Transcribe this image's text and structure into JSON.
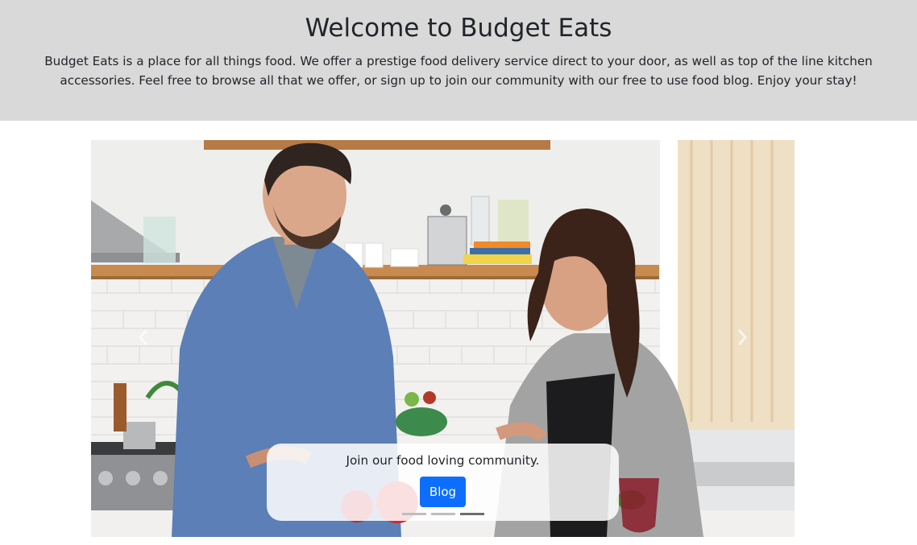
{
  "header": {
    "title": "Welcome to Budget Eats",
    "intro": "Budget Eats is a place for all things food. We offer a prestige food delivery service direct to your door, as well as top of the line kitchen accessories. Feel free to browse all that we offer, or sign up to join our community with our free to use food blog. Enjoy your stay!"
  },
  "carousel": {
    "prev_icon": "chevron-left-icon",
    "next_icon": "chevron-right-icon",
    "active_slide": 3,
    "slide_count": 3,
    "caption": {
      "text": "Join our food loving community.",
      "button_label": "Blog"
    }
  },
  "colors": {
    "header_bg": "#d9d9d9",
    "button_bg": "#0d6efd"
  }
}
